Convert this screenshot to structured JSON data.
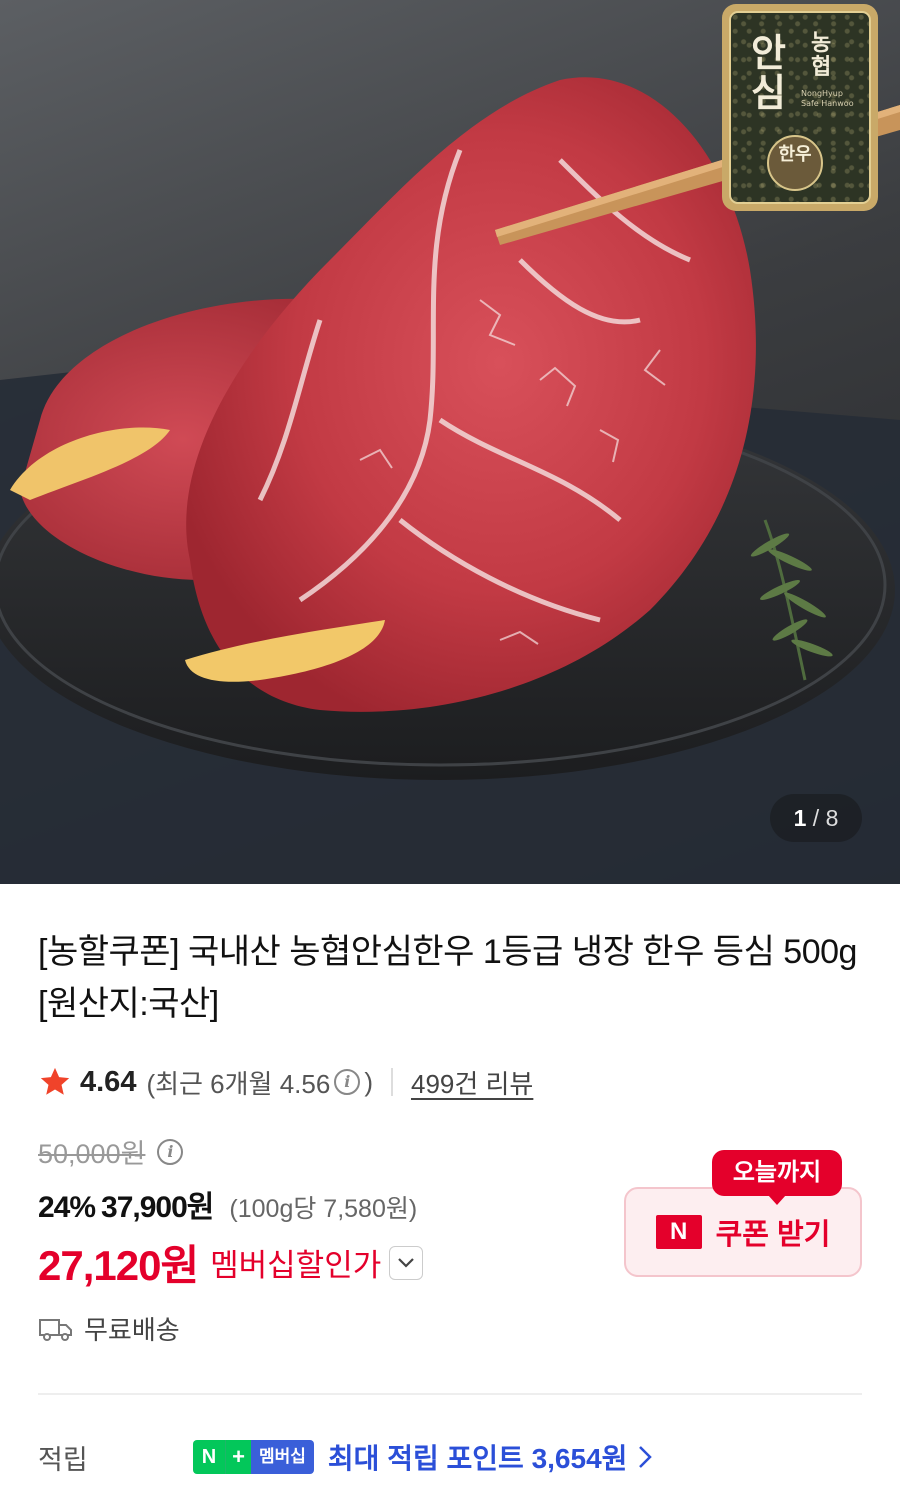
{
  "hero": {
    "badge_main": "안심",
    "badge_side": "농협",
    "badge_en": "NongHyup Safe Hanwoo",
    "badge_seal": "한우",
    "page_current": "1",
    "page_separator": "/",
    "page_total": "8"
  },
  "product": {
    "title": "[농할쿠폰] 국내산 농협안심한우 1등급 냉장 한우 등심 500g [원산지:국산]",
    "rating": "4.64",
    "rating_recent": "(최근 6개월 4.56",
    "rating_recent_close": ")",
    "review_link": "499건 리뷰"
  },
  "price": {
    "original": "50,000원",
    "discount_rate": "24%",
    "sale_price": "37,900원",
    "unit_price": "(100g당 7,580원)",
    "member_price": "27,120원",
    "member_label": "멤버십할인가"
  },
  "coupon": {
    "today_tag": "오늘까지",
    "n_logo": "N",
    "label": "쿠폰 받기"
  },
  "shipping": {
    "text": "무료배송"
  },
  "points": {
    "label": "적립",
    "badge_n": "N",
    "badge_plus": "+",
    "badge_member": "멤버십",
    "text": "최대 적립 포인트 3,654원"
  },
  "colors": {
    "accent_red": "#e4002b",
    "naver_green": "#03c75a",
    "points_blue": "#2b4fd8"
  }
}
